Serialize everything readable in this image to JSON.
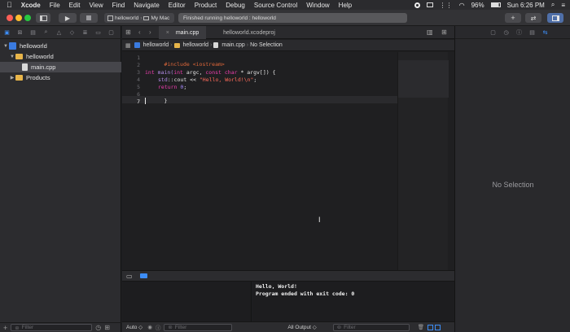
{
  "menubar": {
    "apple": "",
    "app_name": "Xcode",
    "items": [
      "File",
      "Edit",
      "View",
      "Find",
      "Navigate",
      "Editor",
      "Product",
      "Debug",
      "Source Control",
      "Window",
      "Help"
    ],
    "battery": "96%",
    "clock": "Sun 6:26 PM"
  },
  "toolbar": {
    "scheme": "helloworld",
    "destination": "My Mac",
    "activity": "Finished running helloworld : helloworld"
  },
  "navigator": {
    "tree": [
      {
        "label": "helloworld",
        "level": 0,
        "kind": "project",
        "expanded": true
      },
      {
        "label": "helloworld",
        "level": 1,
        "kind": "folder",
        "expanded": true
      },
      {
        "label": "main.cpp",
        "level": 2,
        "kind": "file",
        "selected": true
      },
      {
        "label": "Products",
        "level": 1,
        "kind": "folder",
        "expanded": false
      }
    ],
    "filter_placeholder": "Filter"
  },
  "editor": {
    "tabs": [
      {
        "label": "main.cpp",
        "active": true
      },
      {
        "label": "helloworld.xcodeproj",
        "active": false
      }
    ],
    "jumpbar": [
      "helloworld",
      "helloworld",
      "main.cpp",
      "No Selection"
    ],
    "line_numbers": [
      "1",
      "2",
      "3",
      "4",
      "5",
      "6",
      "7"
    ],
    "code": {
      "l1_pp": "#include <iostream>",
      "l3_kw1": "int",
      "l3_fn": " main(",
      "l3_kw2": "int",
      "l3_mid": " argc, ",
      "l3_kw3": "const char",
      "l3_end": " * argv[]) {",
      "l4_ns": "std",
      "l4_mid": "::cout << ",
      "l4_str": "\"Hello, World!\\n\"",
      "l4_end": ";",
      "l5_kw": "return",
      "l5_num": "0",
      "l5_end": ";",
      "l6": "}"
    }
  },
  "debug": {
    "console_lines": [
      "Hello, World!",
      "Program ended with exit code: 0"
    ],
    "auto_label": "Auto ◇",
    "vars_filter_placeholder": "Filter",
    "output_label": "All Output ◇",
    "console_filter_placeholder": "Filter"
  },
  "inspector": {
    "empty_label": "No Selection"
  }
}
